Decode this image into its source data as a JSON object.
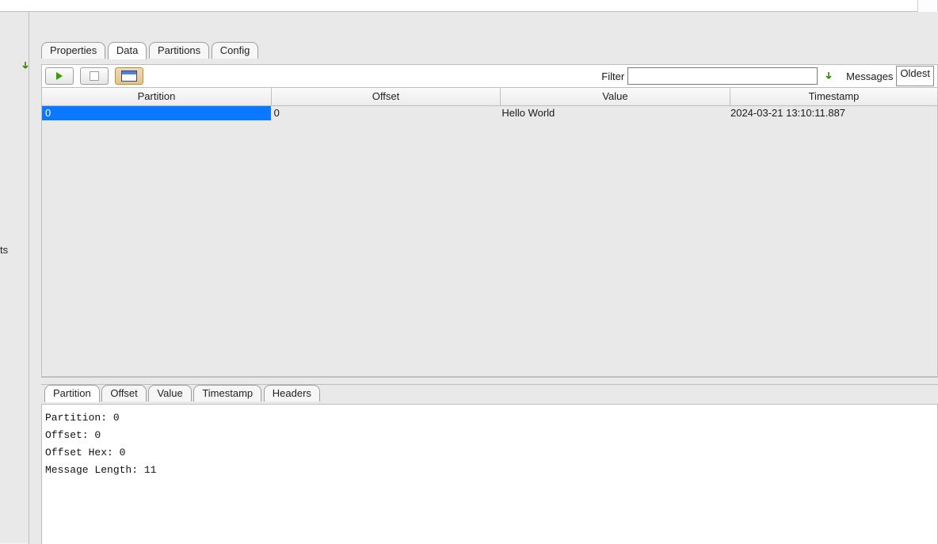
{
  "left": {
    "fragment": "ts"
  },
  "tabs": {
    "properties": "Properties",
    "data": "Data",
    "partitions": "Partitions",
    "config": "Config",
    "active": "data"
  },
  "toolbar": {
    "filter_label": "Filter",
    "filter_value": "",
    "messages_label": "Messages",
    "messages_selected": "Oldest"
  },
  "grid": {
    "columns": {
      "partition": "Partition",
      "offset": "Offset",
      "value": "Value",
      "timestamp": "Timestamp"
    },
    "rows": [
      {
        "partition": "0",
        "offset": "0",
        "value": "Hello World",
        "timestamp": "2024-03-21 13:10:11.887"
      }
    ]
  },
  "detailTabs": {
    "partition": "Partition",
    "offset": "Offset",
    "value": "Value",
    "timestamp": "Timestamp",
    "headers": "Headers",
    "active": "partition"
  },
  "detail": {
    "l1": "Partition: 0",
    "l2": "Offset: 0",
    "l3": "Offset Hex: 0",
    "l4": "Message Length: 11"
  }
}
